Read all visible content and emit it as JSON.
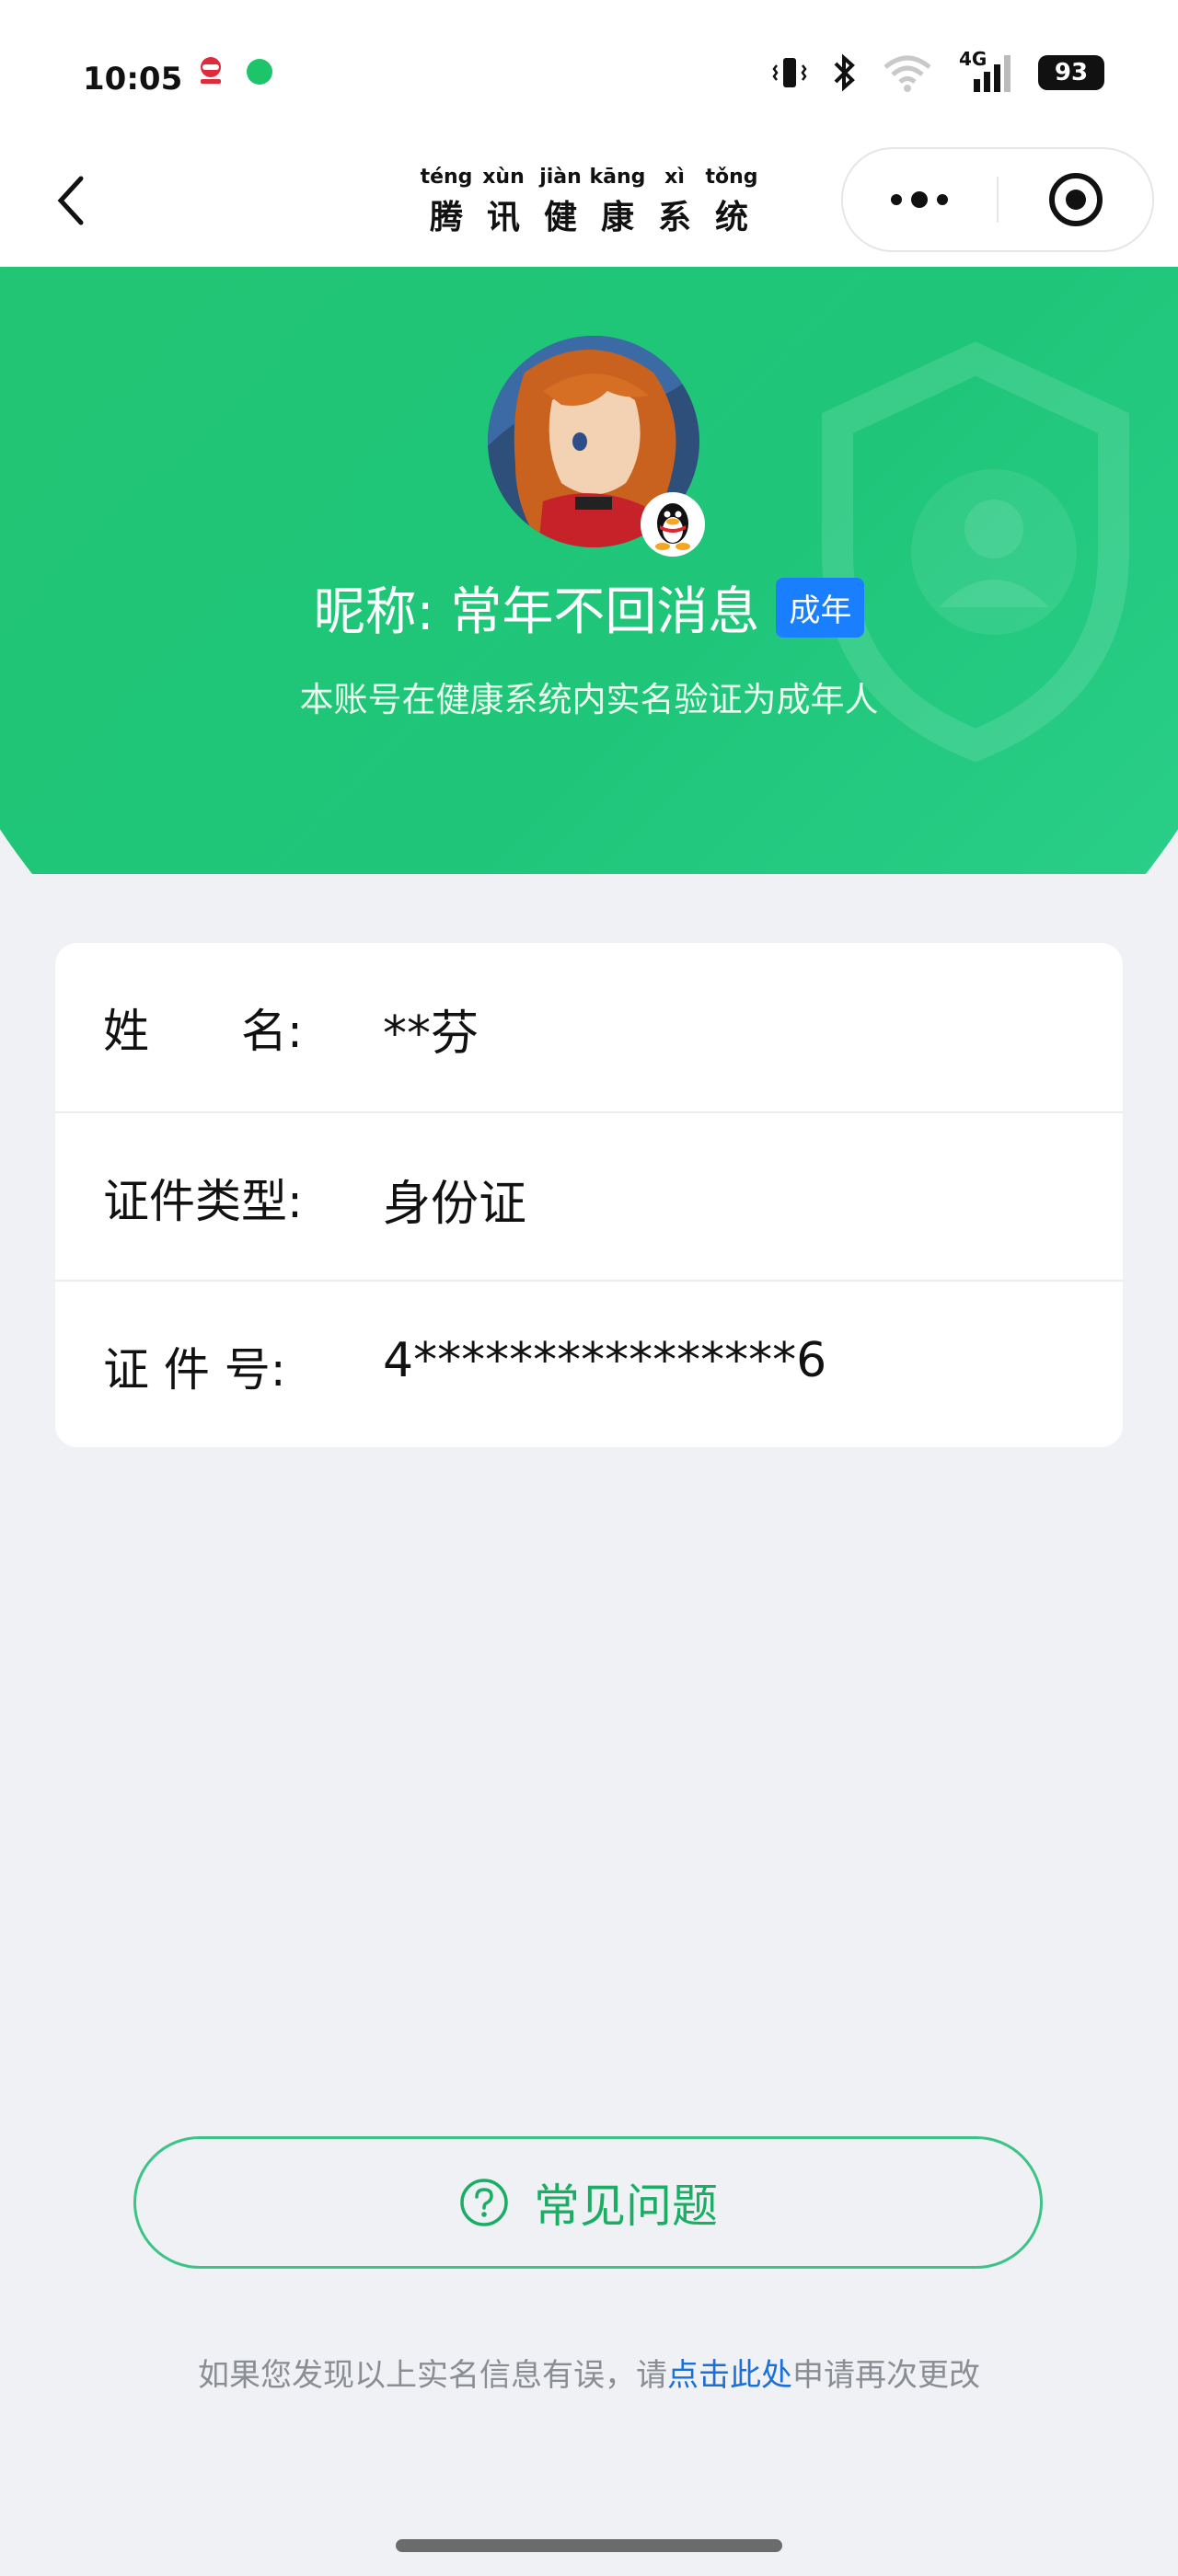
{
  "status_bar": {
    "time": "10:05",
    "network": "4G",
    "battery": "93"
  },
  "nav": {
    "title_chars": [
      {
        "pinyin": "téng",
        "hanzi": "腾"
      },
      {
        "pinyin": "xùn",
        "hanzi": "讯"
      },
      {
        "pinyin": "jiàn",
        "hanzi": "健"
      },
      {
        "pinyin": "kāng",
        "hanzi": "康"
      },
      {
        "pinyin": "xì",
        "hanzi": "系"
      },
      {
        "pinyin": "tǒng",
        "hanzi": "统"
      }
    ]
  },
  "profile": {
    "nickname": "昵称: 常年不回消息",
    "badge": "成年",
    "verification_text": "本账号在健康系统内实名验证为成年人"
  },
  "info": {
    "name_label": "姓　　名:",
    "name_value": "**芬",
    "id_type_label": "证件类型:",
    "id_type_value": "身份证",
    "id_number_label": "证 件 号:",
    "id_number_value": "4****************6"
  },
  "faq_label": "常见问题",
  "footer": {
    "prefix": "如果您发现以上实名信息有误，请",
    "link": "点击此处",
    "suffix": "申请再次更改"
  },
  "colors": {
    "brand_green": "#23c46f",
    "badge_blue": "#1a7fff",
    "link_blue": "#1a6fd8"
  }
}
